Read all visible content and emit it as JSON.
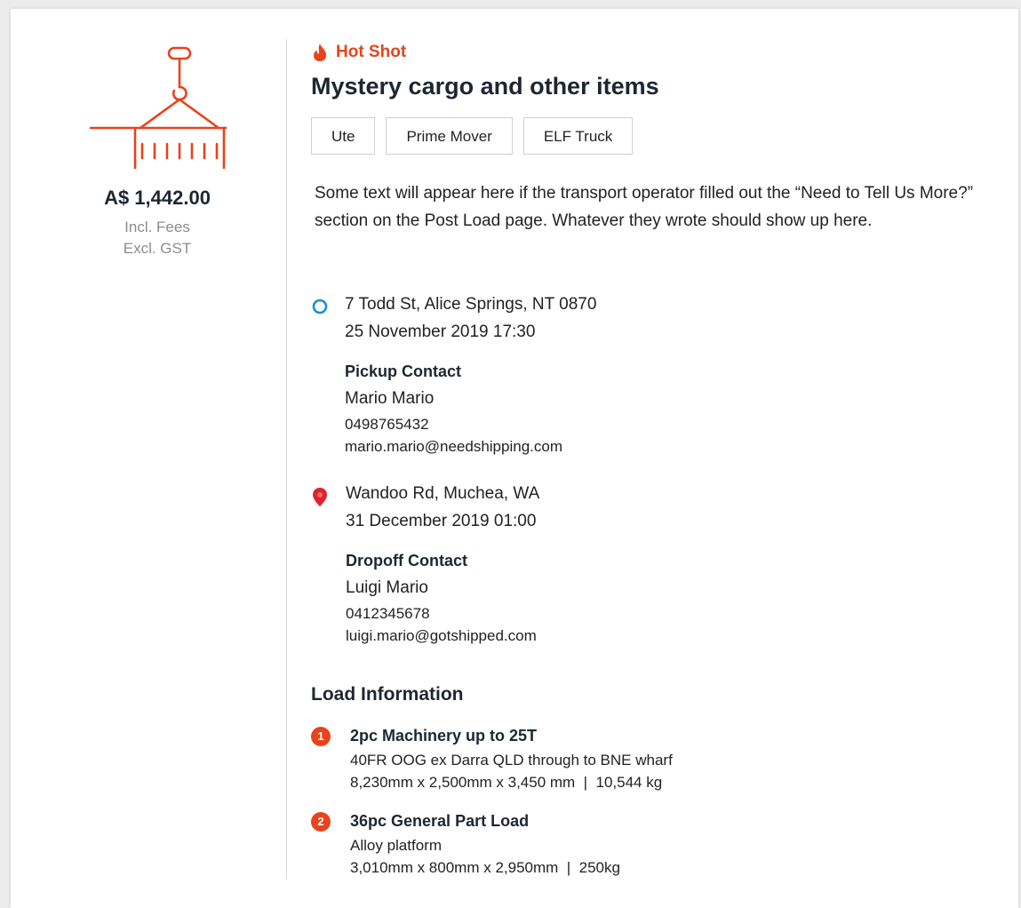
{
  "colors": {
    "accent": "#e8431c",
    "pickup_marker": "#1a8fd8",
    "dropoff_marker": "#e0232b",
    "title": "#1d2731",
    "muted": "#8a8d90"
  },
  "summary": {
    "icon": "container-crane-icon",
    "price": "A$ 1,442.00",
    "fees_note": "Incl. Fees",
    "gst_note": "Excl. GST"
  },
  "listing": {
    "badge_icon": "flame-icon",
    "badge_label": "Hot Shot",
    "title": "Mystery cargo and other items",
    "vehicle_tags": [
      "Ute",
      "Prime Mover",
      "ELF Truck"
    ],
    "description": "Some text will appear here if the transport operator filled out the “Need to Tell Us More?” section on the Post Load page. Whatever they wrote should show up here."
  },
  "pickup": {
    "icon": "pickup-circle-icon",
    "address": "7 Todd St, Alice Springs, NT 0870",
    "datetime": "25 November 2019 17:30",
    "contact_title": "Pickup Contact",
    "contact_name": "Mario Mario",
    "contact_phone": "0498765432",
    "contact_email": "mario.mario@needshipping.com"
  },
  "dropoff": {
    "icon": "map-pin-icon",
    "address": "Wandoo Rd, Muchea, WA",
    "datetime": "31 December 2019 01:00",
    "contact_title": "Dropoff Contact",
    "contact_name": "Luigi Mario",
    "contact_phone": "0412345678",
    "contact_email": "luigi.mario@gotshipped.com"
  },
  "load": {
    "heading": "Load Information",
    "items": [
      {
        "number": "1",
        "name": "2pc Machinery up to 25T",
        "description": "40FR OOG ex Darra QLD through to BNE wharf",
        "dimensions": "8,230mm x 2,500mm x 3,450 mm  |  10,544 kg"
      },
      {
        "number": "2",
        "name": "36pc General Part Load",
        "description": "Alloy platform",
        "dimensions": "3,010mm x 800mm x 2,950mm  |  250kg"
      }
    ]
  }
}
